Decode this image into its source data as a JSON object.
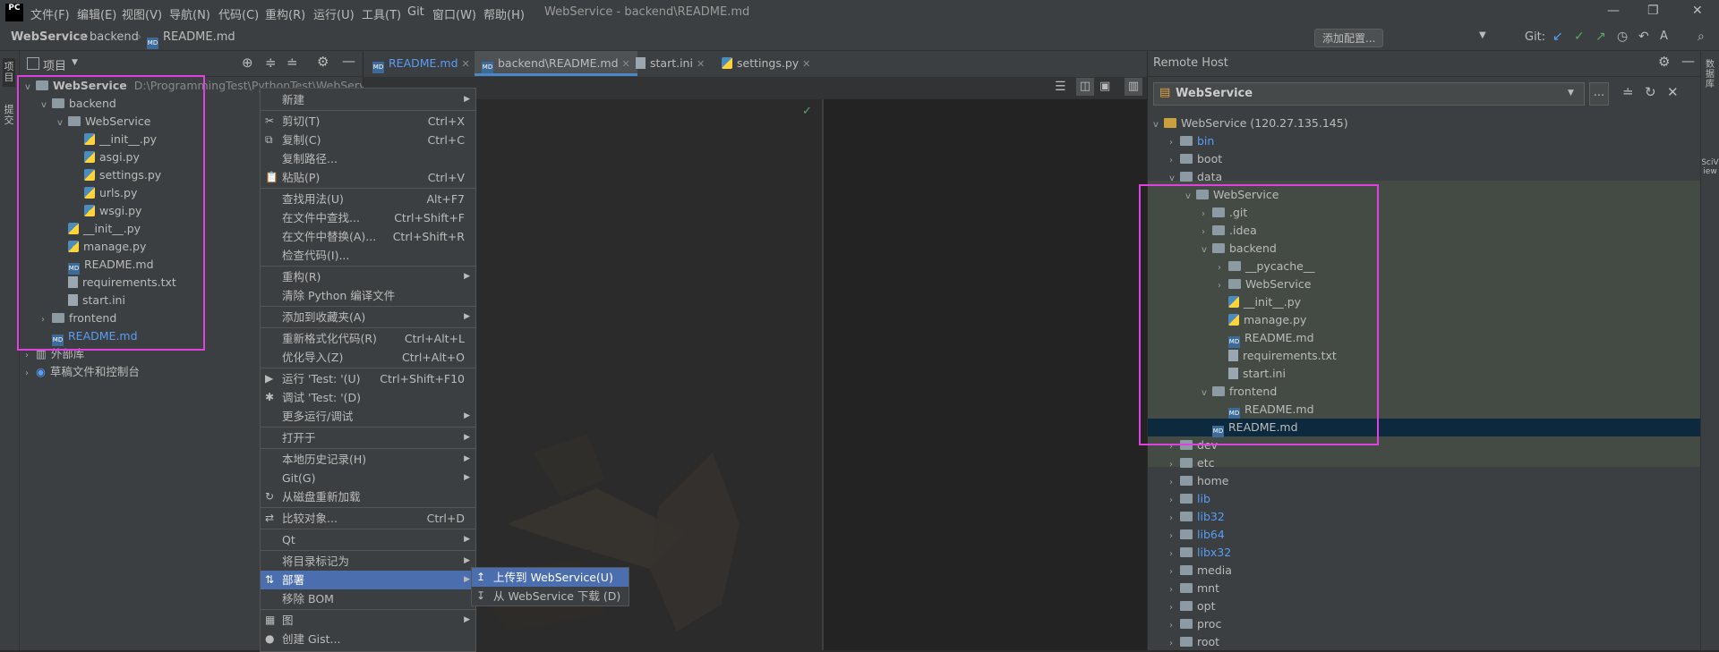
{
  "titlebar": {
    "logo": "PC",
    "menus": [
      "文件(F)",
      "编辑(E)",
      "视图(V)",
      "导航(N)",
      "代码(C)",
      "重构(R)",
      "运行(U)",
      "工具(T)",
      "Git",
      "窗口(W)",
      "帮助(H)"
    ],
    "title": "WebService - backend\\README.md"
  },
  "navbar": {
    "crumbs": [
      "WebService",
      "backend",
      "README.md"
    ],
    "add_config": "添加配置...",
    "git_label": "Git:"
  },
  "left_strip": {
    "labels": [
      "项目",
      "提交"
    ]
  },
  "project_panel": {
    "title": "项目",
    "root_name": "WebService",
    "root_path": "D:\\ProgrammingTest\\PythonTest\\WebService",
    "items": [
      {
        "label": "backend",
        "type": "folder",
        "depth": 1,
        "arrow": "v"
      },
      {
        "label": "WebService",
        "type": "folder",
        "depth": 2,
        "arrow": "v"
      },
      {
        "label": "__init__.py",
        "type": "py",
        "depth": 3
      },
      {
        "label": "asgi.py",
        "type": "py",
        "depth": 3
      },
      {
        "label": "settings.py",
        "type": "py",
        "depth": 3
      },
      {
        "label": "urls.py",
        "type": "py",
        "depth": 3
      },
      {
        "label": "wsgi.py",
        "type": "py",
        "depth": 3
      },
      {
        "label": "__init__.py",
        "type": "py",
        "depth": 2
      },
      {
        "label": "manage.py",
        "type": "py",
        "depth": 2
      },
      {
        "label": "README.md",
        "type": "md",
        "depth": 2
      },
      {
        "label": "requirements.txt",
        "type": "txt",
        "depth": 2
      },
      {
        "label": "start.ini",
        "type": "txt",
        "depth": 2
      },
      {
        "label": "frontend",
        "type": "folder",
        "depth": 1,
        "arrow": ">"
      },
      {
        "label": "README.md",
        "type": "md",
        "depth": 1,
        "blue": true
      },
      {
        "label": "外部库",
        "type": "lib",
        "depth": 0,
        "arrow": ">"
      },
      {
        "label": "草稿文件和控制台",
        "type": "scratch",
        "depth": 0,
        "arrow": ">"
      }
    ]
  },
  "editor_tabs": [
    "README.md",
    "backend\\README.md",
    "start.ini",
    "settings.py"
  ],
  "context_menu": {
    "items": [
      {
        "label": "新建",
        "sub": true
      },
      {
        "sep": true
      },
      {
        "label": "剪切(T)",
        "shortcut": "Ctrl+X",
        "icon": "✂"
      },
      {
        "label": "复制(C)",
        "shortcut": "Ctrl+C",
        "icon": "⧉"
      },
      {
        "label": "复制路径..."
      },
      {
        "label": "粘贴(P)",
        "shortcut": "Ctrl+V",
        "icon": "📋"
      },
      {
        "sep": true
      },
      {
        "label": "查找用法(U)",
        "shortcut": "Alt+F7"
      },
      {
        "label": "在文件中查找...",
        "shortcut": "Ctrl+Shift+F"
      },
      {
        "label": "在文件中替换(A)...",
        "shortcut": "Ctrl+Shift+R"
      },
      {
        "label": "检查代码(I)..."
      },
      {
        "sep": true
      },
      {
        "label": "重构(R)",
        "sub": true
      },
      {
        "label": "清除 Python 编译文件"
      },
      {
        "sep": true
      },
      {
        "label": "添加到收藏夹(A)",
        "sub": true
      },
      {
        "sep": true
      },
      {
        "label": "重新格式化代码(R)",
        "shortcut": "Ctrl+Alt+L"
      },
      {
        "label": "优化导入(Z)",
        "shortcut": "Ctrl+Alt+O"
      },
      {
        "sep": true
      },
      {
        "label": "运行 'Test: '(U)",
        "shortcut": "Ctrl+Shift+F10",
        "icon": "▶"
      },
      {
        "label": "调试 'Test: '(D)",
        "icon": "✱"
      },
      {
        "label": "更多运行/调试",
        "sub": true
      },
      {
        "sep": true
      },
      {
        "label": "打开于",
        "sub": true
      },
      {
        "sep": true
      },
      {
        "label": "本地历史记录(H)",
        "sub": true
      },
      {
        "label": "Git(G)",
        "sub": true
      },
      {
        "label": "从磁盘重新加载",
        "icon": "↻"
      },
      {
        "sep": true
      },
      {
        "label": "比较对象...",
        "shortcut": "Ctrl+D",
        "icon": "⇄"
      },
      {
        "sep": true
      },
      {
        "label": "Qt",
        "sub": true
      },
      {
        "sep": true
      },
      {
        "label": "将目录标记为",
        "sub": true
      },
      {
        "label": "部署",
        "sub": true,
        "selected": true,
        "icon": "⇅"
      },
      {
        "label": "移除 BOM"
      },
      {
        "sep": true
      },
      {
        "label": "图",
        "sub": true,
        "icon": "▦"
      },
      {
        "label": "创建 Gist...",
        "icon": "●"
      }
    ]
  },
  "submenu": {
    "items": [
      {
        "label": "上传到 WebService(U)",
        "icon": "↥",
        "selected": true
      },
      {
        "label": "从 WebService 下载 (D)",
        "icon": "↧"
      }
    ]
  },
  "remote": {
    "title": "Remote Host",
    "server": "WebService",
    "root": "WebService (120.27.135.145)",
    "items": [
      {
        "label": "bin",
        "depth": 1,
        "arrow": ">",
        "blue": true
      },
      {
        "label": "boot",
        "depth": 1,
        "arrow": ">"
      },
      {
        "label": "data",
        "depth": 1,
        "arrow": "v"
      },
      {
        "label": "WebService",
        "depth": 2,
        "arrow": "v"
      },
      {
        "label": ".git",
        "depth": 3,
        "arrow": ">"
      },
      {
        "label": ".idea",
        "depth": 3,
        "arrow": ">"
      },
      {
        "label": "backend",
        "depth": 3,
        "arrow": "v"
      },
      {
        "label": "__pycache__",
        "depth": 4,
        "arrow": ">"
      },
      {
        "label": "WebService",
        "depth": 4,
        "arrow": ">"
      },
      {
        "label": "__init__.py",
        "depth": 4,
        "type": "py"
      },
      {
        "label": "manage.py",
        "depth": 4,
        "type": "py"
      },
      {
        "label": "README.md",
        "depth": 4,
        "type": "md"
      },
      {
        "label": "requirements.txt",
        "depth": 4,
        "type": "txt"
      },
      {
        "label": "start.ini",
        "depth": 4,
        "type": "txt"
      },
      {
        "label": "frontend",
        "depth": 3,
        "arrow": "v"
      },
      {
        "label": "README.md",
        "depth": 4,
        "type": "md"
      },
      {
        "label": "README.md",
        "depth": 3,
        "type": "md",
        "selected": true
      },
      {
        "label": "dev",
        "depth": 1,
        "arrow": ">"
      },
      {
        "label": "etc",
        "depth": 1,
        "arrow": ">"
      },
      {
        "label": "home",
        "depth": 1,
        "arrow": ">"
      },
      {
        "label": "lib",
        "depth": 1,
        "arrow": ">",
        "blue": true
      },
      {
        "label": "lib32",
        "depth": 1,
        "arrow": ">",
        "blue": true
      },
      {
        "label": "lib64",
        "depth": 1,
        "arrow": ">",
        "blue": true
      },
      {
        "label": "libx32",
        "depth": 1,
        "arrow": ">",
        "blue": true
      },
      {
        "label": "media",
        "depth": 1,
        "arrow": ">"
      },
      {
        "label": "mnt",
        "depth": 1,
        "arrow": ">"
      },
      {
        "label": "opt",
        "depth": 1,
        "arrow": ">"
      },
      {
        "label": "proc",
        "depth": 1,
        "arrow": ">"
      },
      {
        "label": "root",
        "depth": 1,
        "arrow": ">"
      }
    ]
  },
  "right_strip": {
    "labels": [
      "数据库",
      "SciView"
    ]
  }
}
